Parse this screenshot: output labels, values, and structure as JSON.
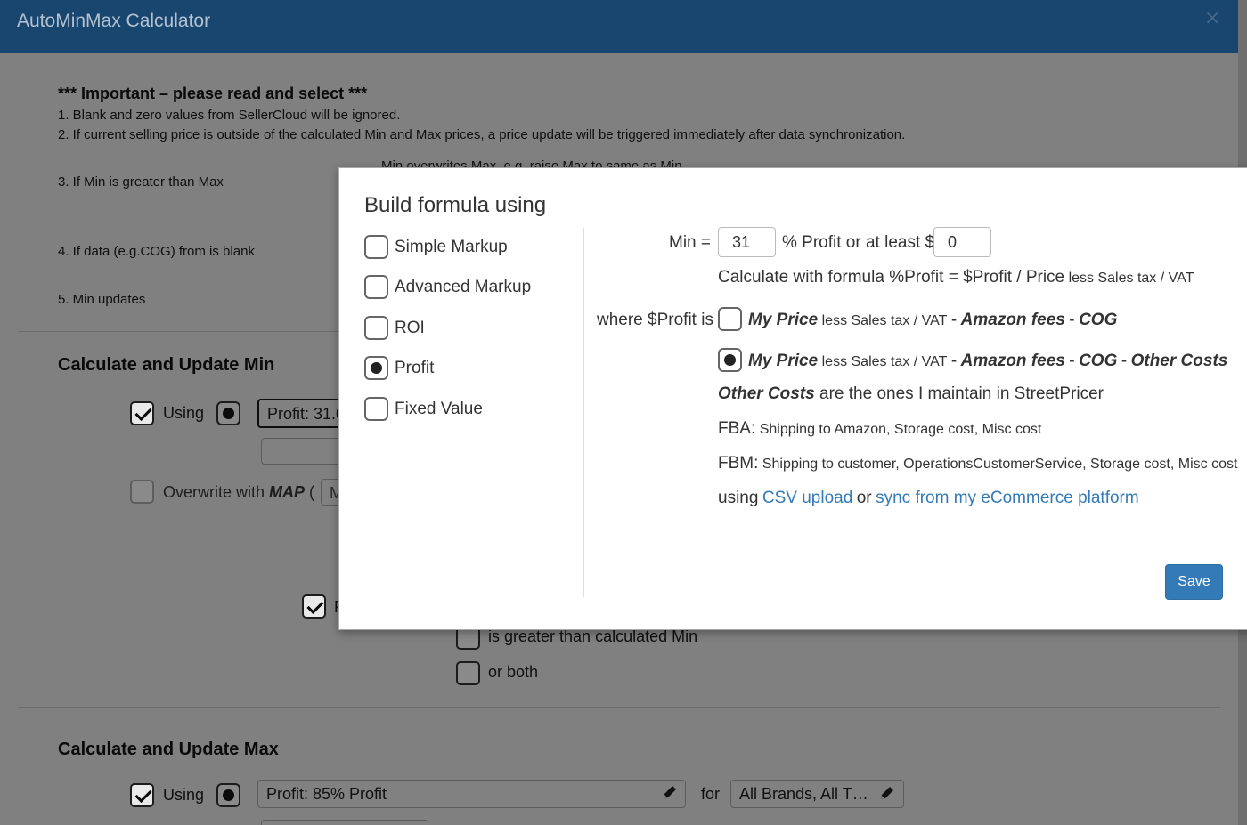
{
  "background": {
    "title": "AutoMinMax Calculator",
    "close_glyph": "×",
    "notes": {
      "heading": "*** Important – please read and select ***",
      "line1": "1. Blank and zero values from SellerCloud will be ignored.",
      "line2": "2. If current selling price is outside of the calculated Min and Max prices, a price update will be triggered immediately after data synchronization.",
      "line3": "3. If Min is greater than Max",
      "line3_option": "Min overwrites Max, e.g. raise Max to same as Min",
      "line4": "4. If data (e.g.COG) from is blank",
      "line5": "5. Min updates"
    },
    "min_section": {
      "title": "Calculate and Update Min",
      "using_label": "Using",
      "formula_value": "Profit: 31.0",
      "overwrite_label": "Overwrite with ",
      "overwrite_map": "MAP",
      "overwrite_paren": " (",
      "overwrite_field": "M",
      "partial_label": "P",
      "cond_greater": "is greater than calculated Min",
      "cond_both": "or both"
    },
    "max_section": {
      "title": "Calculate and Update Max",
      "using_label": "Using",
      "formula_value": "Profit: 85% Profit",
      "for_label": "for",
      "brands_value": "All Brands,  All T…"
    }
  },
  "modal": {
    "title": "Build formula using",
    "options": [
      {
        "label": "Simple Markup",
        "selected": false
      },
      {
        "label": "Advanced Markup",
        "selected": false
      },
      {
        "label": "ROI",
        "selected": false
      },
      {
        "label": "Profit",
        "selected": true
      },
      {
        "label": "Fixed Value",
        "selected": false
      }
    ],
    "min_label": "Min =",
    "min_percent": "31",
    "percent_text": "% Profit or at least $",
    "min_dollar": "0",
    "calc_prefix": "Calculate with formula %Profit = $Profit / Price",
    "calc_suffix": "less Sales tax / VAT",
    "where_label": "where $Profit is",
    "profit_options": [
      {
        "my_price": "My Price",
        "less": "less Sales tax / VAT",
        "dash1": "-",
        "fees": "Amazon fees",
        "dash2": "-",
        "cog": "COG",
        "dash3": "",
        "other": "",
        "selected": false
      },
      {
        "my_price": "My Price",
        "less": "less Sales tax / VAT",
        "dash1": "-",
        "fees": "Amazon fees",
        "dash2": "-",
        "cog": "COG",
        "dash3": "-",
        "other": "Other Costs",
        "selected": true
      }
    ],
    "other_costs_bold": "Other Costs",
    "other_costs_rest": " are the ones I maintain in StreetPricer",
    "fba_label": "FBA:",
    "fba_text": "Shipping to Amazon, Storage cost, Misc cost",
    "fbm_label": "FBM:",
    "fbm_text": "Shipping to customer, OperationsCustomerService, Storage cost, Misc cost",
    "using_text": "using",
    "csv_link": "CSV upload",
    "or_text": "or",
    "sync_link": "sync from my eCommerce platform",
    "save_label": "Save"
  },
  "icons": {
    "pencil": "pencil-icon",
    "close": "close-icon",
    "check": "checkmark-icon"
  }
}
